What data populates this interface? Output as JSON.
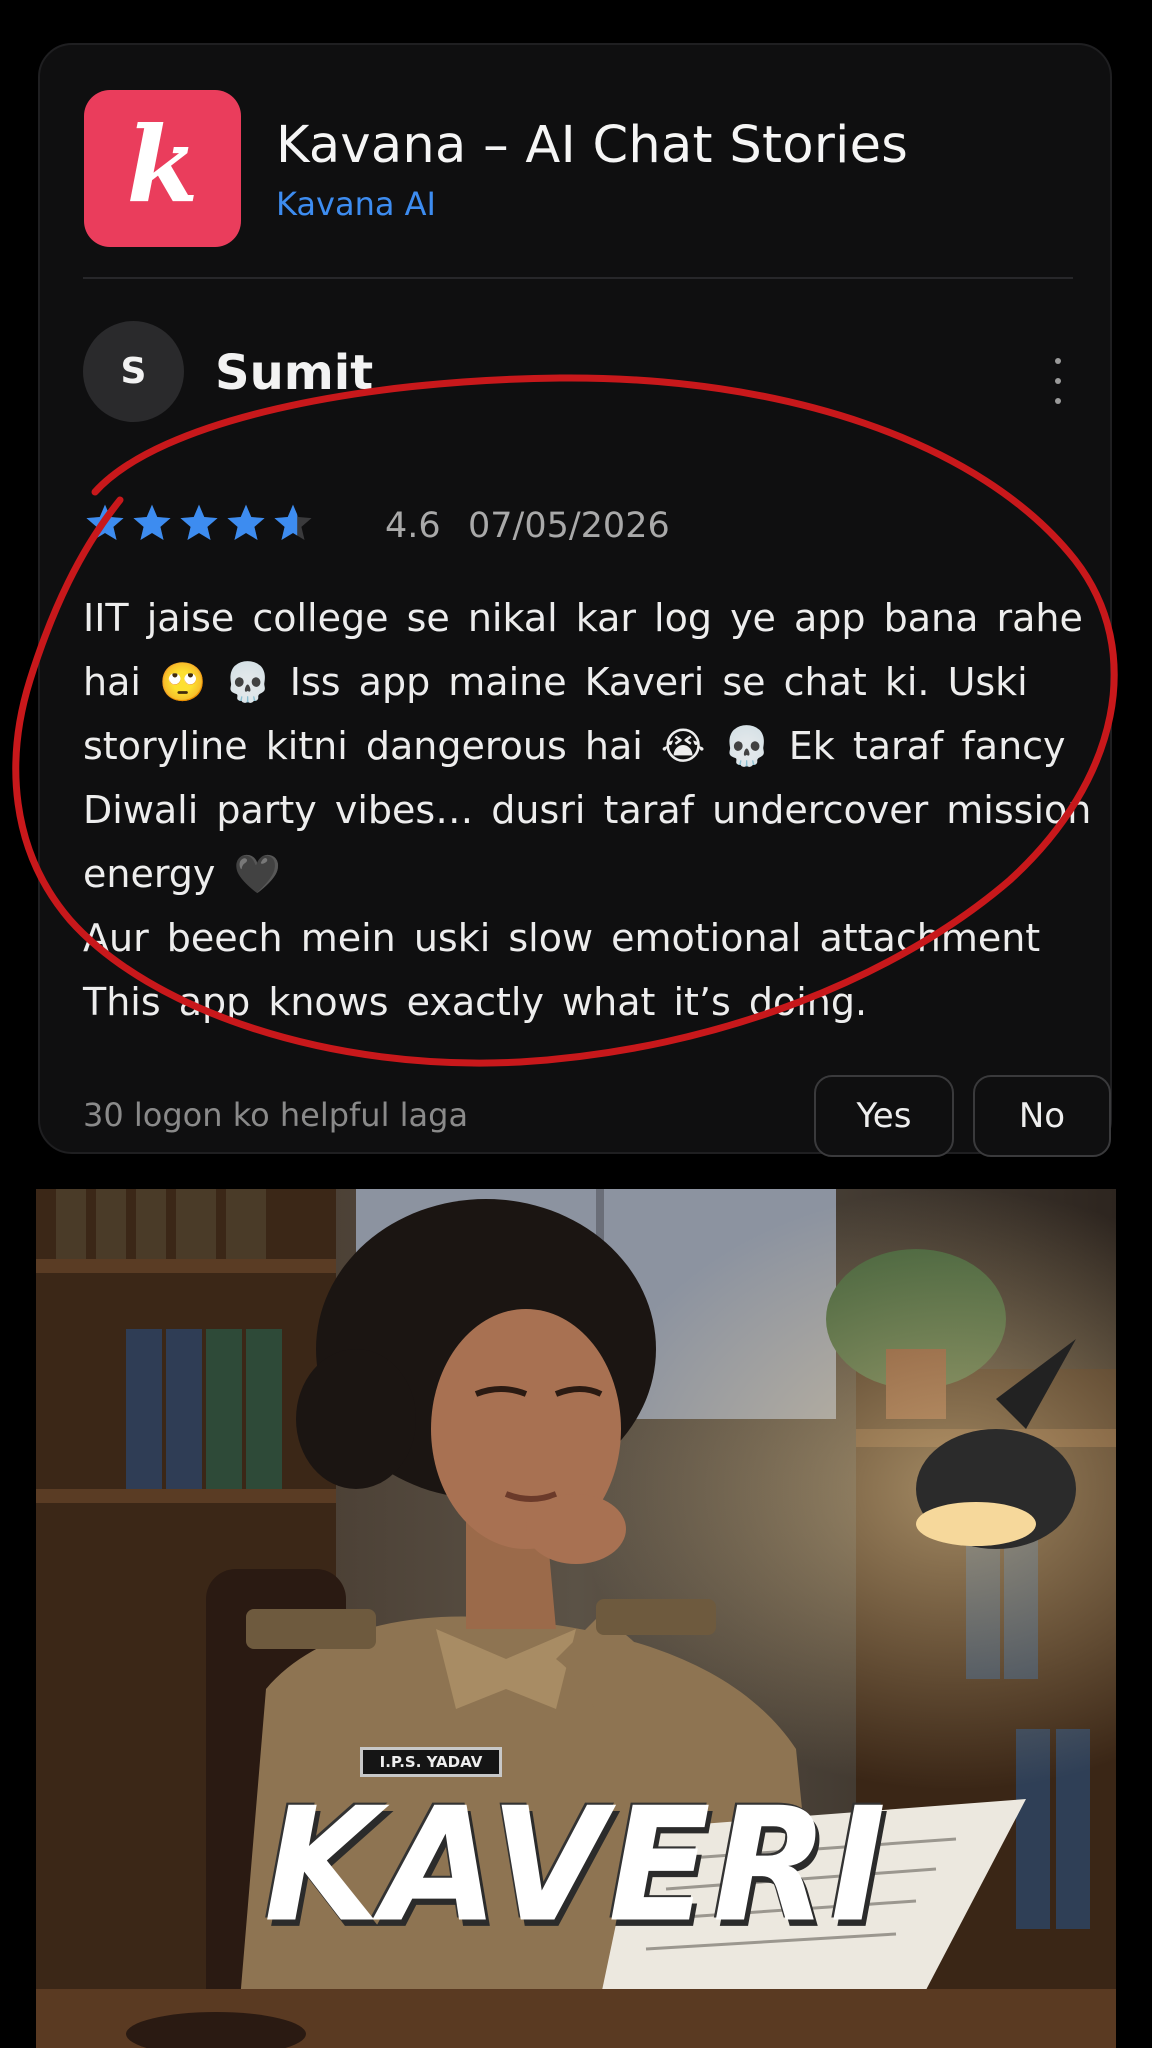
{
  "app": {
    "icon_letter": "k",
    "title": "Kavana – AI Chat Stories",
    "developer": "Kavana AI",
    "brand_color": "#ea3d5c",
    "developer_color": "#3d8cf0"
  },
  "review": {
    "avatar_initial": "S",
    "reviewer_name": "Sumit",
    "more_icon": "more-vertical-icon",
    "stars_value": 4.6,
    "rating_text": "4.6",
    "date": "07/05/2026",
    "star_color": "#3d8cf0",
    "text_lines": [
      "IIT jaise college se nikal kar log ye app bana rahe",
      "hai 🙄 💀 Iss app maine Kaveri se chat ki. Uski",
      "storyline kitni dangerous hai 😭 💀 Ek taraf fancy",
      "Diwali party vibes… dusri taraf undercover mission",
      "energy 🖤",
      "Aur beech mein uski slow emotional attachment",
      "This app knows exactly what it’s doing."
    ],
    "helpful_text": "30 logon ko helpful laga",
    "yes_label": "Yes",
    "no_label": "No"
  },
  "annotation": {
    "shape": "hand-drawn ellipse",
    "color": "#c8181b"
  },
  "poster": {
    "title": "KAVERI",
    "nameplate": "I.P.S. YADAV"
  }
}
